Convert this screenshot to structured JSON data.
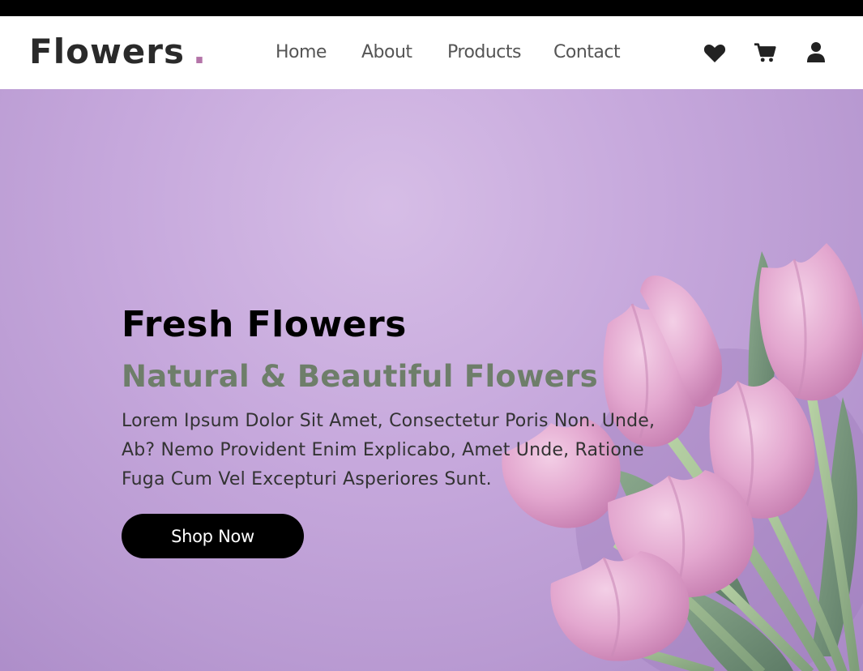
{
  "brand": {
    "name": "Flowers",
    "dot": "."
  },
  "nav": {
    "items": [
      {
        "label": "Home"
      },
      {
        "label": "About"
      },
      {
        "label": "Products"
      },
      {
        "label": "Contact"
      }
    ]
  },
  "header_icons": [
    "heart-icon",
    "cart-icon",
    "user-icon"
  ],
  "hero": {
    "title": "Fresh Flowers",
    "subtitle": "Natural & Beautiful Flowers",
    "text": "Lorem Ipsum Dolor Sit Amet, Consectetur Poris Non. Unde, Ab? Nemo Provident Enim Explicabo, Amet Unde, Ratione Fuga Cum Vel Excepturi Asperiores Sunt.",
    "button_label": "Shop Now"
  },
  "colors": {
    "accent_dot": "#b474a8",
    "subtitle": "#6e7e6a",
    "hero_background": "#c6a8dc",
    "button": "#000000",
    "header_background": "#ffffff"
  }
}
